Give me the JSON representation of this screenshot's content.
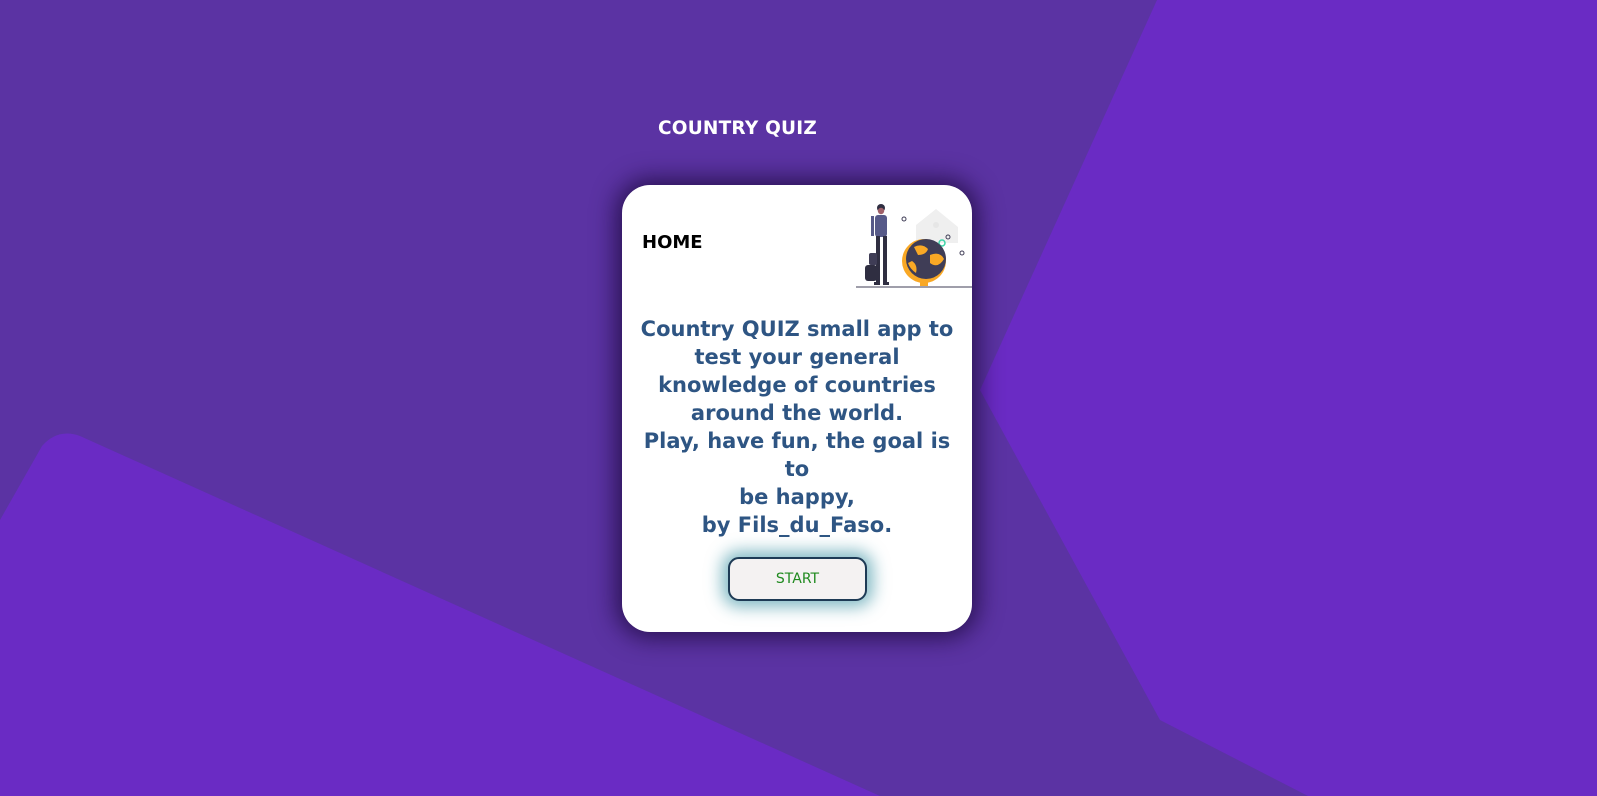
{
  "page": {
    "title": "COUNTRY QUIZ",
    "colors": {
      "background": "#5b33a3",
      "accent_shape": "#6a2bc4",
      "card": "#ffffff",
      "text_primary": "#2e5583",
      "button_text": "#1f8a1f"
    }
  },
  "card": {
    "heading": "HOME",
    "illustration": "traveler-with-globe",
    "description_lines": [
      "Country QUIZ small app to",
      "test your general",
      "knowledge of countries",
      "around the world.",
      "Play, have fun, the goal is to",
      "be happy,",
      "by Fils_du_Faso."
    ],
    "start_label": "START"
  }
}
